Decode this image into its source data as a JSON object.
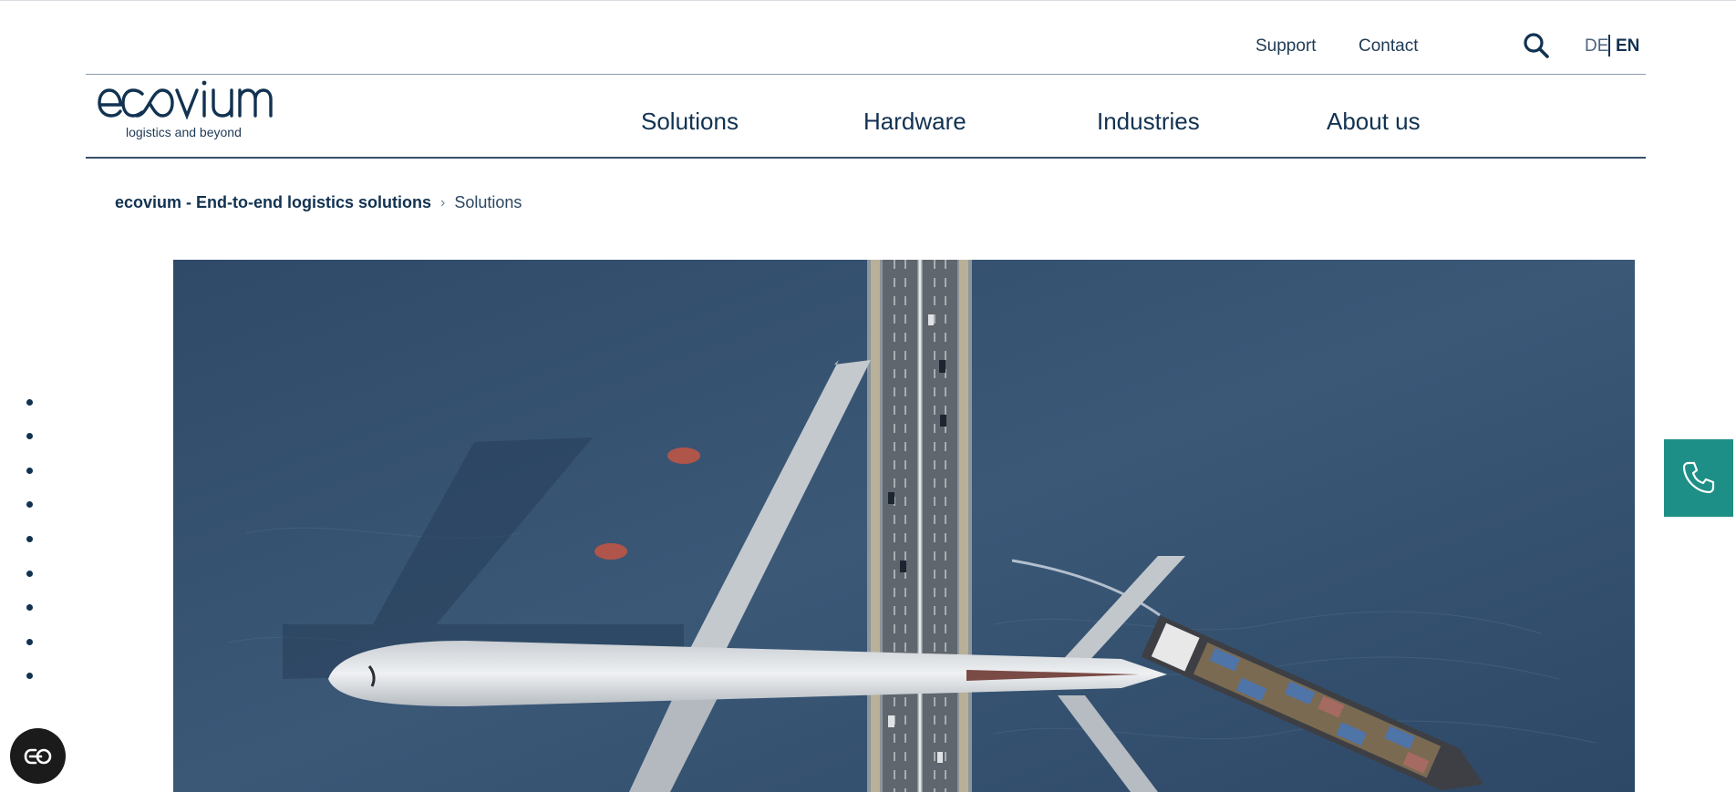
{
  "utility_nav": {
    "support": "Support",
    "contact": "Contact",
    "search_icon": "search-icon",
    "lang_de": "DE",
    "lang_en": "EN",
    "active_language": "EN"
  },
  "logo": {
    "name": "ecovium",
    "tagline": "logistics and beyond"
  },
  "main_nav": {
    "items": [
      {
        "label": "Solutions"
      },
      {
        "label": "Hardware"
      },
      {
        "label": "Industries"
      },
      {
        "label": "About us"
      }
    ]
  },
  "breadcrumb": {
    "home": "ecovium - End-to-end logistics solutions",
    "separator": "›",
    "current": "Solutions"
  },
  "hero": {
    "image": "Aerial view of an airplane flying over a highway bridge and a container ship on water"
  },
  "side_nav": {
    "dot_count": 9
  },
  "floating": {
    "phone_icon": "phone-icon",
    "accessibility_icon": "accessibility-icon"
  },
  "colors": {
    "brand_navy": "#123251",
    "accent_teal": "#1e8f86",
    "hero_water": "#3a5674"
  }
}
